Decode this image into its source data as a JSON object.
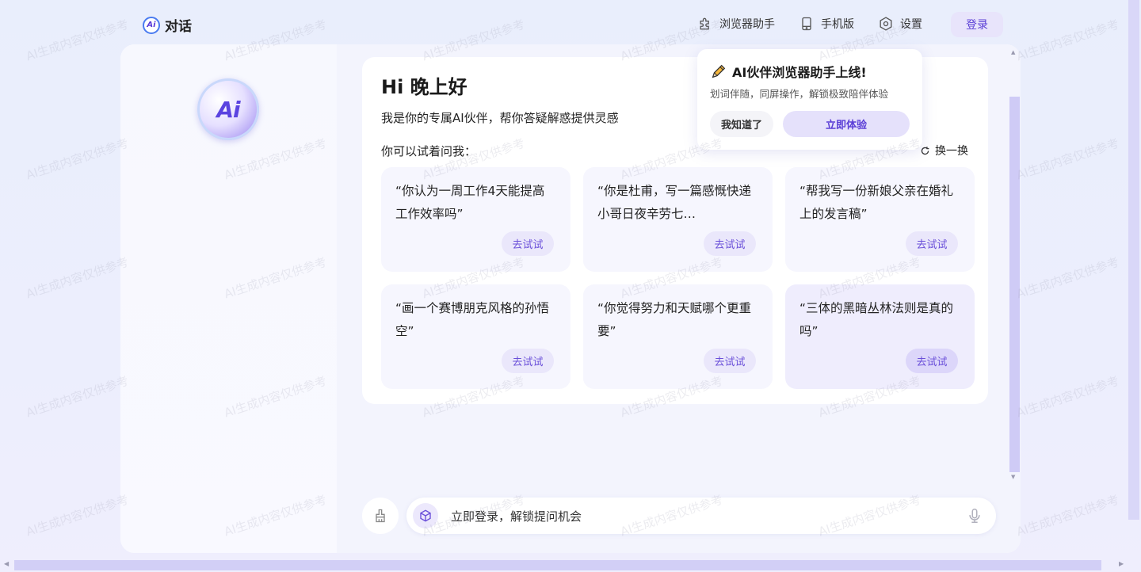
{
  "header": {
    "logo_text": "Ai",
    "title": "对话",
    "nav": [
      {
        "label": "浏览器助手",
        "icon": "puzzle-icon"
      },
      {
        "label": "手机版",
        "icon": "mobile-icon"
      },
      {
        "label": "设置",
        "icon": "gear-icon"
      }
    ],
    "login_label": "登录"
  },
  "avatar": {
    "text": "Ai"
  },
  "chat": {
    "greeting": "Hi 晚上好",
    "intro": "我是你的专属AI伙伴，帮你答疑解惑提供灵感",
    "try_label": "你可以试着问我：",
    "refresh_label": "换一换",
    "questions": [
      {
        "text": "“你认为一周工作4天能提高工作效率吗”",
        "button": "去试试"
      },
      {
        "text": "“你是杜甫，写一篇感慨快递小哥日夜辛劳七…",
        "button": "去试试"
      },
      {
        "text": "“帮我写一份新娘父亲在婚礼上的发言稿”",
        "button": "去试试"
      },
      {
        "text": "“画一个赛博朋克风格的孙悟空”",
        "button": "去试试"
      },
      {
        "text": "“你觉得努力和天赋哪个更重要”",
        "button": "去试试"
      },
      {
        "text": "“三体的黑暗丛林法则是真的吗”",
        "button": "去试试"
      }
    ]
  },
  "input": {
    "placeholder": "立即登录，解锁提问机会"
  },
  "popover": {
    "title": "AI伙伴浏览器助手上线!",
    "description": "划词伴随，同屏操作，解锁极致陪伴体验",
    "dismiss_label": "我知道了",
    "try_label": "立即体验"
  },
  "watermark": "AI生成内容仅供参考",
  "colors": {
    "accent": "#5b3fd6",
    "panel_bg": "#f3f4fd",
    "button_bg": "#eae7fb"
  }
}
